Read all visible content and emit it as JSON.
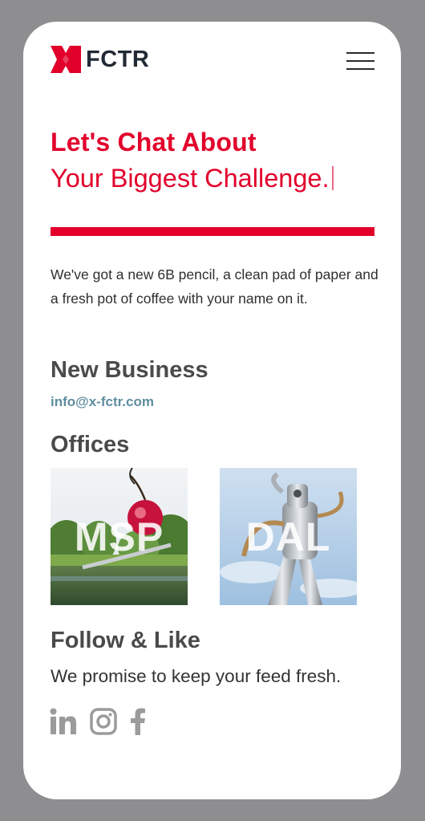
{
  "header": {
    "logo_text": "FCTR",
    "menu_icon": "hamburger-menu-icon",
    "brand_color": "#e2002b"
  },
  "hero": {
    "title_line1": "Let's Chat About",
    "title_line2": "Your Biggest Challenge."
  },
  "intro_text": "We've got a new 6B pencil, a clean pad of paper and a fresh pot of coffee with your name on it.",
  "new_business": {
    "heading": "New Business",
    "email": "info@x-fctr.com"
  },
  "offices": {
    "heading": "Offices",
    "items": [
      {
        "label": "MSP",
        "image": "spoonbridge-and-cherry-photo"
      },
      {
        "label": "DAL",
        "image": "traveling-man-sculpture-photo"
      }
    ]
  },
  "follow": {
    "heading": "Follow & Like",
    "subtext": "We promise to keep your feed fresh.",
    "icons": [
      "linkedin-icon",
      "instagram-icon",
      "facebook-icon"
    ]
  }
}
